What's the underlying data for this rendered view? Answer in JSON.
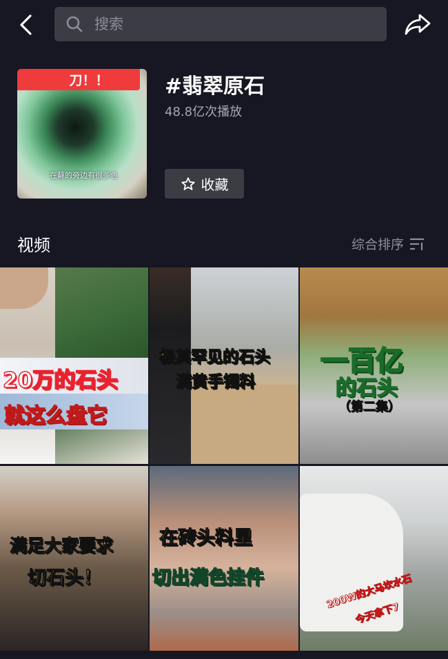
{
  "header": {
    "search_placeholder": "搜索"
  },
  "topic": {
    "title": "#翡翠原石",
    "plays": "48.8亿次播放",
    "favorite_label": "收藏",
    "cover_badge": "刀！！",
    "cover_caption": "在藓的旁边有很多色"
  },
  "section": {
    "title": "视频",
    "sort_label": "综合排序"
  },
  "videos": [
    {
      "line1": "20万的石头",
      "line2": "就这么盘它"
    },
    {
      "line1": "极其罕见的石头",
      "line2": "满黄手镯料"
    },
    {
      "line1": "一百亿",
      "line2": "的石头",
      "line3": "（第二集）"
    },
    {
      "line1": "满足大家要求",
      "line2": "切石头！"
    },
    {
      "line1": "在砖头料里",
      "line2": "切出满色挂件"
    },
    {
      "line1": "200W的大马坎水石",
      "line2": "今天拿下7"
    }
  ],
  "colors": {
    "background": "#161722",
    "search_bg": "#3b3c44",
    "muted_text": "#a6a7ad"
  }
}
